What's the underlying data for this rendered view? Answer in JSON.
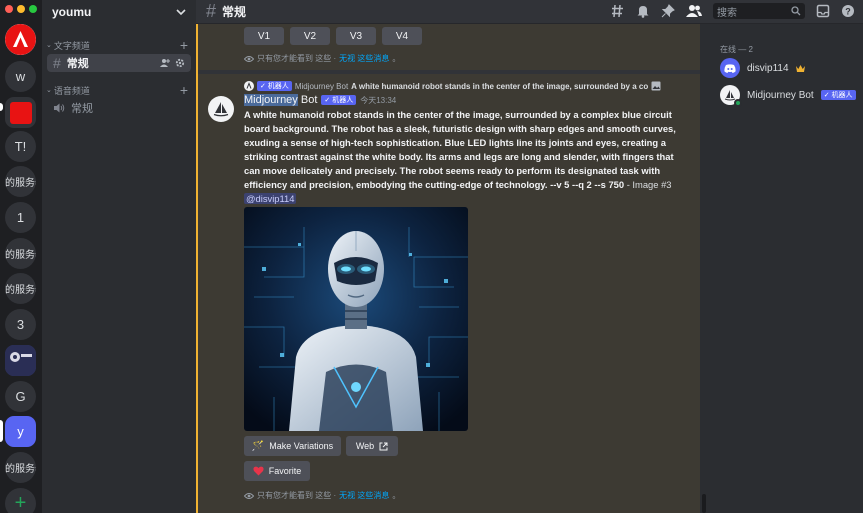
{
  "colors": {
    "accent": "#5865f2",
    "online": "#23a55a",
    "highlight_border": "#f0b232",
    "link": "#00a8fc",
    "crown": "#f0b232"
  },
  "window": {
    "traffic_lights": [
      "#ff5f57",
      "#febc2e",
      "#28c840"
    ]
  },
  "servers": [
    {
      "label": "",
      "icon": "adobe-logo"
    },
    {
      "label": "w"
    },
    {
      "label": "",
      "icon": "red-square"
    },
    {
      "label": "T!"
    },
    {
      "label": "的服务器"
    },
    {
      "label": "1"
    },
    {
      "label": "的服务器"
    },
    {
      "label": "的服务器"
    },
    {
      "label": "3"
    },
    {
      "label": "",
      "icon": "server-image"
    },
    {
      "label": "G"
    },
    {
      "label": "y"
    },
    {
      "label": "的服务器"
    },
    {
      "label": "+",
      "icon": "add-server-icon"
    }
  ],
  "guild": {
    "name": "youmu"
  },
  "categories": {
    "text": "文字频道",
    "voice": "语音频道"
  },
  "channels": {
    "text_channel": "常规",
    "voice_channel": "常规"
  },
  "topbar": {
    "channel_name": "常规",
    "search_placeholder": "搜索"
  },
  "previous_message": {
    "buttons": [
      "V1",
      "V2",
      "V3",
      "V4"
    ],
    "ephemeral_prefix": "只有您才能看到 这些 ·",
    "ephemeral_link": "无视 这些消息",
    "ephemeral_suffix": "。"
  },
  "message": {
    "reply_bot_tag": "✓ 机器人",
    "reply_author": "Midjourney Bot",
    "reply_text": "A white humanoid robot stands in the center of the image, surrounded by a co",
    "author_first": "Midjourney",
    "author_rest": "Bot",
    "bot_tag": "✓ 机器人",
    "timestamp": "今天13:34",
    "prompt": "A white humanoid robot stands in the center of the image, surrounded by a complex blue circuit board background. The robot has a sleek, futuristic design with sharp edges and smooth curves, exuding a sense of high-tech sophistication. Blue LED lights line its joints and eyes, creating a striking contrast against the white body. Its arms and legs are long and slender, with fingers that can move delicately and precisely. The robot seems ready to perform its designated task with efficiency and precision, embodying the cutting-edge of technology. --v 5 --q 2 --s 750",
    "tail": " - Image #3 ",
    "mention": "@disvip114",
    "buttons": {
      "make_variations": "Make Variations",
      "web": "Web",
      "favorite": "Favorite"
    },
    "ephemeral_prefix": "只有您才能看到 这些 ·",
    "ephemeral_link": "无视 这些消息",
    "ephemeral_suffix": "。"
  },
  "members": {
    "header": "在线 — 2",
    "list": [
      {
        "name": "disvip114",
        "icon": "discord-avatar",
        "badge": "crown-icon"
      },
      {
        "name": "Midjourney Bot",
        "icon": "midjourney-avatar",
        "tag": "✓ 机器人"
      }
    ]
  }
}
